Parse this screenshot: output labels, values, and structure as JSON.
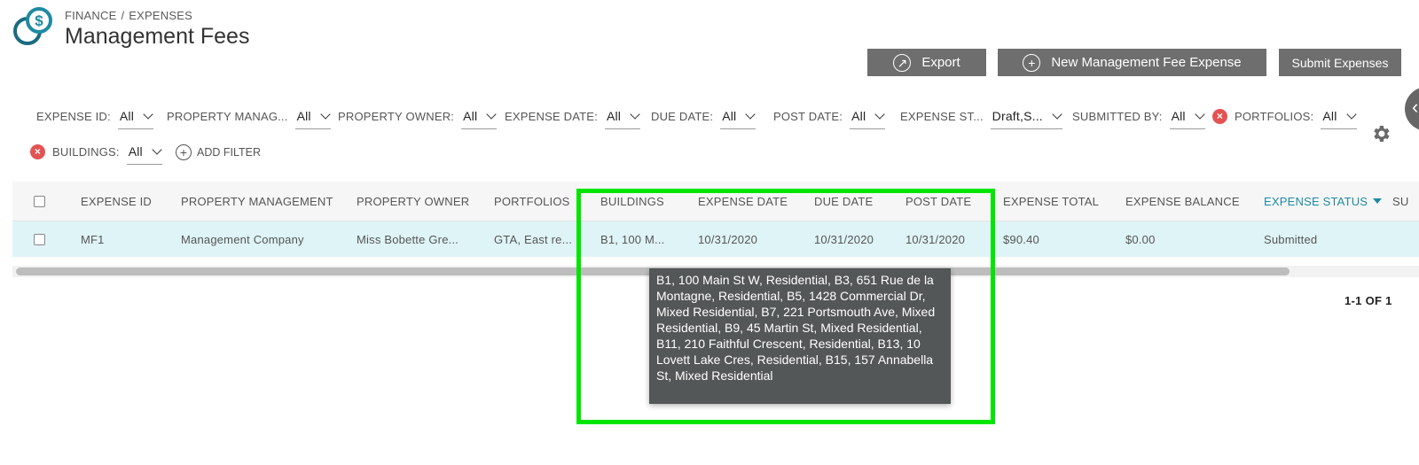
{
  "breadcrumb": {
    "section": "FINANCE",
    "separator": "/",
    "page": "EXPENSES"
  },
  "page_title": "Management Fees",
  "actions": {
    "export": "Export",
    "new_expense": "New Management Fee Expense",
    "submit": "Submit Expenses"
  },
  "filters": {
    "expense_id": {
      "label": "EXPENSE ID:",
      "value": "All"
    },
    "property_management": {
      "label": "PROPERTY MANAG...",
      "value": "All"
    },
    "property_owner": {
      "label": "PROPERTY OWNER:",
      "value": "All"
    },
    "expense_date": {
      "label": "EXPENSE DATE:",
      "value": "All"
    },
    "due_date": {
      "label": "DUE DATE:",
      "value": "All"
    },
    "post_date": {
      "label": "POST DATE:",
      "value": "All"
    },
    "expense_status": {
      "label": "EXPENSE ST...",
      "value": "Draft,S..."
    },
    "submitted_by": {
      "label": "SUBMITTED BY:",
      "value": "All"
    },
    "portfolios": {
      "label": "PORTFOLIOS:",
      "value": "All"
    },
    "buildings": {
      "label": "BUILDINGS:",
      "value": "All"
    },
    "add_filter": "ADD FILTER"
  },
  "table": {
    "headers": {
      "expense_id": "EXPENSE ID",
      "property_management": "PROPERTY MANAGEMENT",
      "property_owner": "PROPERTY OWNER",
      "portfolios": "PORTFOLIOS",
      "buildings": "BUILDINGS",
      "expense_date": "EXPENSE DATE",
      "due_date": "DUE DATE",
      "post_date": "POST DATE",
      "expense_total": "EXPENSE TOTAL",
      "expense_balance": "EXPENSE BALANCE",
      "expense_status": "EXPENSE STATUS",
      "submitted_cut": "SU"
    },
    "rows": [
      {
        "expense_id": "MF1",
        "property_management": "Management Company",
        "property_owner": "Miss Bobette Gre...",
        "portfolios": "GTA, East re...",
        "buildings": "B1, 100 M...",
        "expense_date": "10/31/2020",
        "due_date": "10/31/2020",
        "post_date": "10/31/2020",
        "expense_total": "$90.40",
        "expense_balance": "$0.00",
        "expense_status": "Submitted"
      }
    ]
  },
  "pagination": "1-1 OF 1",
  "tooltip": "B1,  100 Main St W, Residential, B3,  651 Rue de la Montagne, Residential, B5,  1428 Commercial Dr, Mixed Residential, B7,  221 Portsmouth Ave, Mixed Residential, B9,  45 Martin St, Mixed Residential, B11,  210 Faithful Crescent, Residential, B13,  10 Lovett Lake Cres, Residential, B15,  157 Annabella St, Mixed Residential",
  "colors": {
    "accent": "#1f8aa3",
    "button": "#6e6e6e",
    "row_highlight": "#dff4f7",
    "tooltip": "#545758",
    "annotation": "#00e600",
    "remove": "#e45353"
  },
  "icons": {
    "logo": "dollar-coins-icon",
    "export": "export-arrow-icon",
    "new": "plus-circle-icon",
    "remove": "remove-filter-icon",
    "add": "add-circle-icon",
    "settings": "gear-icon",
    "collapse": "chevron-left-icon"
  }
}
